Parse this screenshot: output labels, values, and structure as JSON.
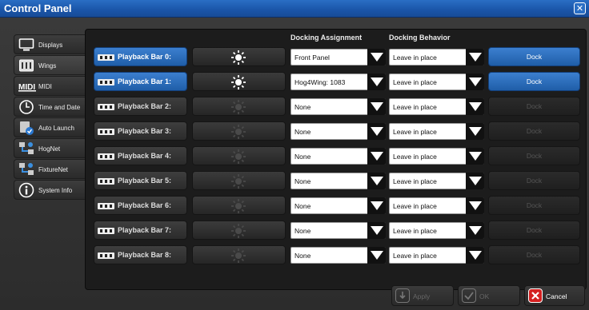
{
  "window": {
    "title": "Control Panel"
  },
  "sidebar": {
    "items": [
      {
        "label": "Displays",
        "icon": "display-icon"
      },
      {
        "label": "Wings",
        "icon": "wing-icon"
      },
      {
        "label": "MIDI",
        "icon": "midi-icon"
      },
      {
        "label": "Time and Date",
        "icon": "clock-icon"
      },
      {
        "label": "Auto Launch",
        "icon": "auto-launch-icon"
      },
      {
        "label": "HogNet",
        "icon": "network-icon"
      },
      {
        "label": "FixtureNet",
        "icon": "network-icon"
      },
      {
        "label": "System Info",
        "icon": "info-icon"
      }
    ],
    "active_index": 1
  },
  "headers": {
    "assignment": "Docking Assignment",
    "behavior": "Docking Behavior"
  },
  "rows": [
    {
      "label": "Playback Bar 0:",
      "assignment": "Front Panel",
      "behavior": "Leave in place",
      "dock": "Dock",
      "enabled": true
    },
    {
      "label": "Playback Bar 1:",
      "assignment": "Hog4Wing: 1083",
      "behavior": "Leave in place",
      "dock": "Dock",
      "enabled": true
    },
    {
      "label": "Playback Bar 2:",
      "assignment": "None",
      "behavior": "Leave in place",
      "dock": "Dock",
      "enabled": false
    },
    {
      "label": "Playback Bar 3:",
      "assignment": "None",
      "behavior": "Leave in place",
      "dock": "Dock",
      "enabled": false
    },
    {
      "label": "Playback Bar 4:",
      "assignment": "None",
      "behavior": "Leave in place",
      "dock": "Dock",
      "enabled": false
    },
    {
      "label": "Playback Bar 5:",
      "assignment": "None",
      "behavior": "Leave in place",
      "dock": "Dock",
      "enabled": false
    },
    {
      "label": "Playback Bar 6:",
      "assignment": "None",
      "behavior": "Leave in place",
      "dock": "Dock",
      "enabled": false
    },
    {
      "label": "Playback Bar 7:",
      "assignment": "None",
      "behavior": "Leave in place",
      "dock": "Dock",
      "enabled": false
    },
    {
      "label": "Playback Bar 8:",
      "assignment": "None",
      "behavior": "Leave in place",
      "dock": "Dock",
      "enabled": false
    }
  ],
  "footer": {
    "apply": "Apply",
    "ok": "OK",
    "cancel": "Cancel"
  },
  "colors": {
    "accent": "#2a6ec4",
    "cancel_red": "#d42020"
  }
}
